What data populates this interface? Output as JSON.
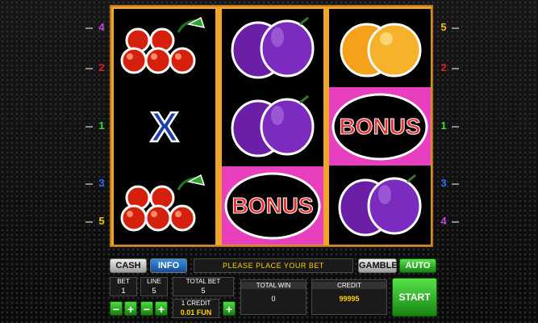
{
  "paylines": {
    "left": [
      "4",
      "2",
      "1",
      "3",
      "5"
    ],
    "right": [
      "5",
      "2",
      "1",
      "3",
      "4"
    ],
    "colors": {
      "1": "#42d93a",
      "2": "#e02020",
      "3": "#2d6bff",
      "4": "#c846e6",
      "5": "#f2c300"
    }
  },
  "reels": [
    [
      "cherries",
      "x",
      "cherries"
    ],
    [
      "plum",
      "plum",
      "bonus"
    ],
    [
      "orange",
      "bonus",
      "plum"
    ]
  ],
  "symbols": {
    "bonus_text": "BONUS",
    "x_text": "X"
  },
  "controls": {
    "cash_label": "CASH",
    "info_label": "INFO",
    "message": "PLEASE PLACE YOUR BET",
    "gamble_label": "GAMBLE",
    "auto_label": "AUTO",
    "start_label": "START",
    "bet_label": "BET",
    "bet_value": "1",
    "line_label": "LINE",
    "line_value": "5",
    "total_bet_label": "TOTAL BET",
    "total_bet_value": "5",
    "credit_unit_label": "1 CREDIT",
    "credit_unit_value": "0.01 FUN",
    "total_win_label": "TOTAL WIN",
    "total_win_value": "0",
    "credit_label": "CREDIT",
    "credit_value": "99995",
    "minus": "−",
    "plus": "+"
  }
}
